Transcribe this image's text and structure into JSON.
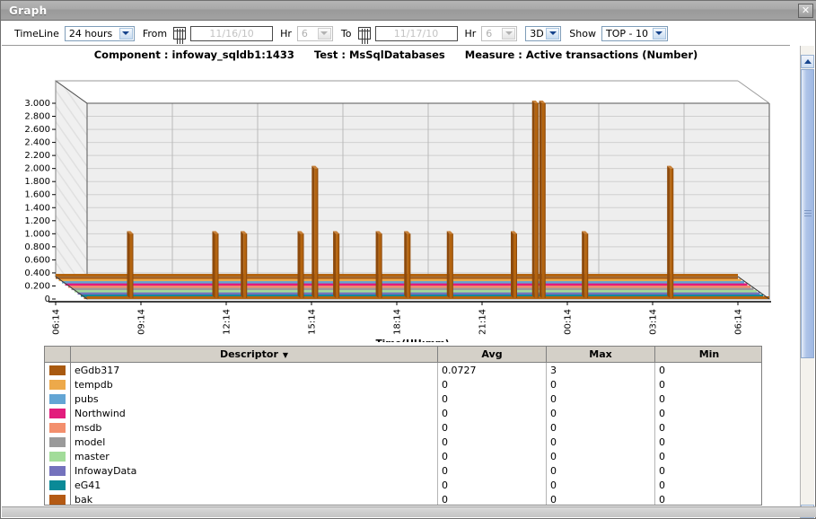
{
  "window": {
    "title": "Graph",
    "close_label": "✕"
  },
  "toolbar": {
    "timeline_label": "TimeLine",
    "timeline_value": "24 hours",
    "from_label": "From",
    "from_value": "11/16/10",
    "from_hr_label": "Hr",
    "from_hr_value": "6",
    "to_label": "To",
    "to_value": "11/17/10",
    "to_hr_label": "Hr",
    "to_hr_value": "6",
    "dimension_value": "3D",
    "show_label": "Show",
    "show_value": "TOP - 10"
  },
  "chart_header": {
    "component": "Component : infoway_sqldb1:1433",
    "test": "Test : MsSqlDatabases",
    "measure": "Measure : Active transactions  (Number)"
  },
  "chart_data": {
    "type": "bar",
    "title": "Component : infoway_sqldb1:1433   Test : MsSqlDatabases   Measure : Active transactions  (Number)",
    "xlabel": "Time(HH:mm)",
    "ylabel": "",
    "ylim": [
      0,
      3.0
    ],
    "ytick_step": 0.2,
    "ytick_labels": [
      "3.000",
      "2.800",
      "2.600",
      "2.400",
      "2.200",
      "2.000",
      "1.800",
      "1.600",
      "1.400",
      "1.200",
      "1.000",
      "0.800",
      "0.600",
      "0.400",
      "0.200",
      "0"
    ],
    "xtick_labels": [
      "06:14",
      "09:14",
      "12:14",
      "15:14",
      "18:14",
      "21:14",
      "00:14",
      "03:14",
      "06:14"
    ],
    "grid": true,
    "legend_position": "table-below",
    "projection": "3D",
    "series": [
      {
        "name": "eGdb317",
        "color": "#a95a10",
        "avg": "0.0727",
        "max": "3",
        "min": "0",
        "points": [
          {
            "t": "07:44",
            "v": 1
          },
          {
            "t": "10:44",
            "v": 1
          },
          {
            "t": "11:44",
            "v": 1
          },
          {
            "t": "13:44",
            "v": 1
          },
          {
            "t": "14:14",
            "v": 2
          },
          {
            "t": "14:59",
            "v": 1
          },
          {
            "t": "16:29",
            "v": 1
          },
          {
            "t": "17:29",
            "v": 1
          },
          {
            "t": "18:59",
            "v": 1
          },
          {
            "t": "21:14",
            "v": 1
          },
          {
            "t": "21:59",
            "v": 3
          },
          {
            "t": "22:14",
            "v": 3
          },
          {
            "t": "23:44",
            "v": 1
          },
          {
            "t": "02:44",
            "v": 2
          }
        ]
      },
      {
        "name": "tempdb",
        "color": "#eda94a",
        "avg": "0",
        "max": "0",
        "min": "0",
        "points": []
      },
      {
        "name": "pubs",
        "color": "#63a5d4",
        "avg": "0",
        "max": "0",
        "min": "0",
        "points": []
      },
      {
        "name": "Northwind",
        "color": "#e21c7c",
        "avg": "0",
        "max": "0",
        "min": "0",
        "points": []
      },
      {
        "name": "msdb",
        "color": "#f38f6d",
        "avg": "0",
        "max": "0",
        "min": "0",
        "points": []
      },
      {
        "name": "model",
        "color": "#9a9a9a",
        "avg": "0",
        "max": "0",
        "min": "0",
        "points": []
      },
      {
        "name": "master",
        "color": "#a2dc9a",
        "avg": "0",
        "max": "0",
        "min": "0",
        "points": []
      },
      {
        "name": "InfowayData",
        "color": "#7472bd",
        "avg": "0",
        "max": "0",
        "min": "0",
        "points": []
      },
      {
        "name": "eG41",
        "color": "#0a8a97",
        "avg": "0",
        "max": "0",
        "min": "0",
        "points": []
      },
      {
        "name": "bak",
        "color": "#b45a14",
        "avg": "0",
        "max": "0",
        "min": "0",
        "points": []
      }
    ]
  },
  "table": {
    "columns": [
      "",
      "Descriptor",
      "Avg",
      "Max",
      "Min"
    ],
    "sort_column": "Descriptor",
    "sort_icon": "▼",
    "rows": [
      {
        "color": "#a95a10",
        "descriptor": "eGdb317",
        "avg": "0.0727",
        "max": "3",
        "min": "0"
      },
      {
        "color": "#eda94a",
        "descriptor": "tempdb",
        "avg": "0",
        "max": "0",
        "min": "0"
      },
      {
        "color": "#63a5d4",
        "descriptor": "pubs",
        "avg": "0",
        "max": "0",
        "min": "0"
      },
      {
        "color": "#e21c7c",
        "descriptor": "Northwind",
        "avg": "0",
        "max": "0",
        "min": "0"
      },
      {
        "color": "#f38f6d",
        "descriptor": "msdb",
        "avg": "0",
        "max": "0",
        "min": "0"
      },
      {
        "color": "#9a9a9a",
        "descriptor": "model",
        "avg": "0",
        "max": "0",
        "min": "0"
      },
      {
        "color": "#a2dc9a",
        "descriptor": "master",
        "avg": "0",
        "max": "0",
        "min": "0"
      },
      {
        "color": "#7472bd",
        "descriptor": "InfowayData",
        "avg": "0",
        "max": "0",
        "min": "0"
      },
      {
        "color": "#0a8a97",
        "descriptor": "eG41",
        "avg": "0",
        "max": "0",
        "min": "0"
      },
      {
        "color": "#b45a14",
        "descriptor": "bak",
        "avg": "0",
        "max": "0",
        "min": "0"
      }
    ]
  },
  "scrollbar": {
    "up_arrow": "▲",
    "down_arrow": "▼"
  }
}
